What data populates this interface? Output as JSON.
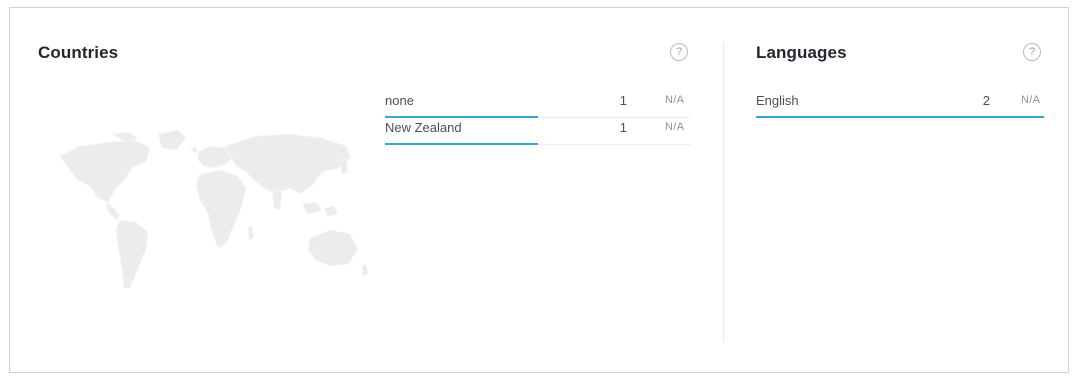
{
  "countries": {
    "title": "Countries",
    "help_icon": "question-circle-icon",
    "rows": [
      {
        "label": "none",
        "count": "1",
        "share": "N/A",
        "bar_fraction": 0.5
      },
      {
        "label": "New Zealand",
        "count": "1",
        "share": "N/A",
        "bar_fraction": 0.5
      }
    ]
  },
  "languages": {
    "title": "Languages",
    "help_icon": "question-circle-icon",
    "rows": [
      {
        "label": "English",
        "count": "2",
        "share": "N/A",
        "bar_fraction": 1.0
      }
    ]
  },
  "help_glyph": "?",
  "colors": {
    "bar": "#33a6d6",
    "map_land": "#ececec",
    "border": "#cfd3d8"
  }
}
